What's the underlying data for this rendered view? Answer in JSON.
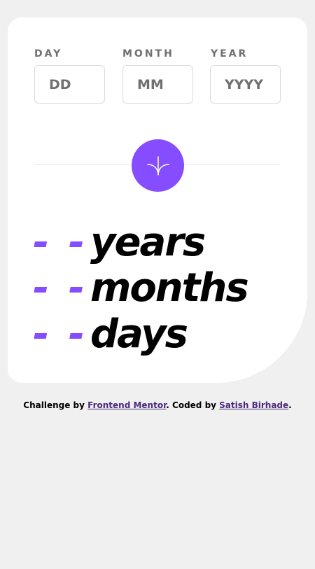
{
  "form": {
    "day": {
      "label": "DAY",
      "placeholder": "DD"
    },
    "month": {
      "label": "MONTH",
      "placeholder": "MM"
    },
    "year": {
      "label": "YEAR",
      "placeholder": "YYYY"
    },
    "submit_icon": "arrow-down-icon"
  },
  "results": {
    "years": {
      "value": "- -",
      "unit": "years"
    },
    "months": {
      "value": "- -",
      "unit": "months"
    },
    "days": {
      "value": "- -",
      "unit": "days"
    }
  },
  "attribution": {
    "prefix": "Challenge by ",
    "link1": "Frontend Mentor",
    "middle": ". Coded by ",
    "link2": "Satish Birhade",
    "suffix": "."
  },
  "colors": {
    "accent": "#854dff",
    "background": "#f0f0f0",
    "card": "#ffffff",
    "label": "#716f6f",
    "border": "#dbdbdb"
  }
}
